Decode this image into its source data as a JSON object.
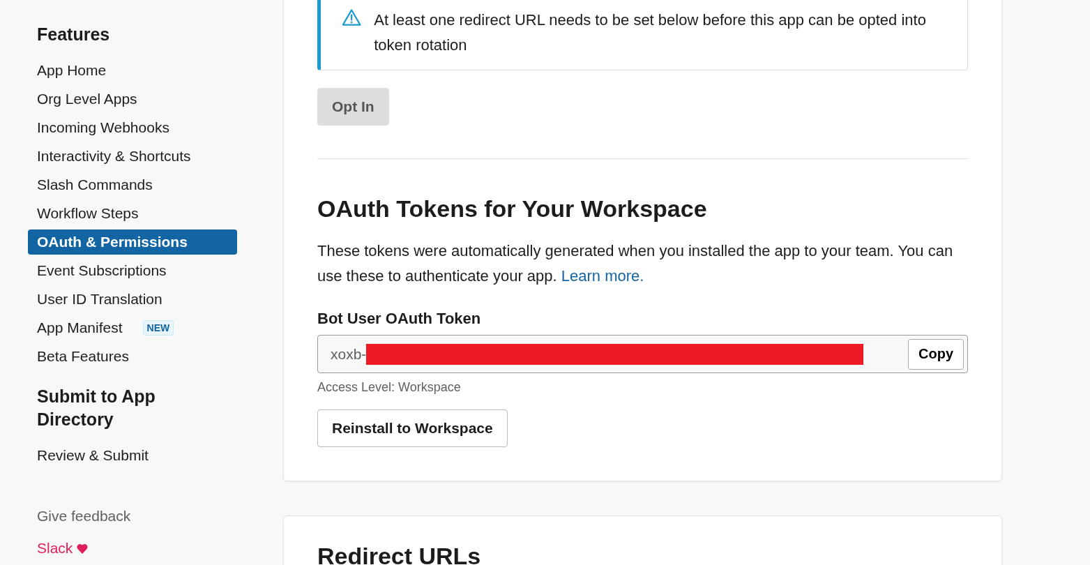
{
  "sidebar": {
    "sections": [
      {
        "title": "Features",
        "items": [
          {
            "label": "App Home",
            "selected": false
          },
          {
            "label": "Org Level Apps",
            "selected": false
          },
          {
            "label": "Incoming Webhooks",
            "selected": false
          },
          {
            "label": "Interactivity & Shortcuts",
            "selected": false
          },
          {
            "label": "Slash Commands",
            "selected": false
          },
          {
            "label": "Workflow Steps",
            "selected": false
          },
          {
            "label": "OAuth & Permissions",
            "selected": true
          },
          {
            "label": "Event Subscriptions",
            "selected": false
          },
          {
            "label": "User ID Translation",
            "selected": false
          },
          {
            "label": "App Manifest",
            "selected": false,
            "badge": "NEW"
          },
          {
            "label": "Beta Features",
            "selected": false
          }
        ]
      },
      {
        "title": "Submit to App Directory",
        "items": [
          {
            "label": "Review & Submit",
            "selected": false
          }
        ]
      }
    ],
    "feedback_link": "Give feedback",
    "footer_link": "Slack"
  },
  "main": {
    "alert": {
      "text": "At least one redirect URL needs to be set below before this app can be opted into token rotation"
    },
    "opt_in_button": {
      "label": "Opt In",
      "disabled": true
    },
    "tokens_section": {
      "title": "OAuth Tokens for Your Workspace",
      "description": "These tokens were automatically generated when you installed the app to your team. You can use these to authenticate your app.",
      "learn_more_link": "Learn more.",
      "token_label": "Bot User OAuth Token",
      "token_field": {
        "value": "xoxb-"
      },
      "copy_button": "Copy",
      "access_level": "Access Level: Workspace",
      "reinstall_button": "Reinstall to Workspace"
    },
    "next_section": {
      "title": "Redirect URLs"
    }
  }
}
